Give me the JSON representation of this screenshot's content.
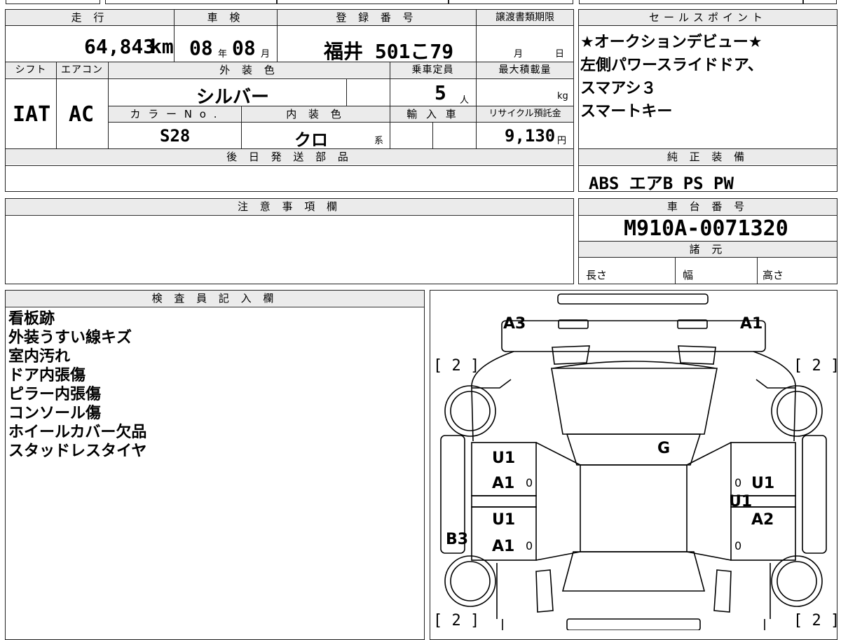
{
  "header": {
    "mileage_label": "走 行",
    "inspection_label": "車 検",
    "registration_label": "登 録 番 号",
    "transfer_label": "譲渡書類期限",
    "sales_label": "セールスポイント",
    "shift_label": "シフト",
    "ac_label": "エアコン",
    "exterior_label": "外 装 色",
    "capacity_label": "乗車定員",
    "max_load_label": "最大積載量",
    "color_no_label": "カ ラ ー N o .",
    "interior_label": "内 装 色",
    "import_label": "輸 入 車",
    "recycle_label": "リサイクル預託金",
    "later_parts_label": "後 日 発 送 部 品",
    "equipment_label": "純 正 装 備",
    "caution_label": "注 意 事 項 欄",
    "chassis_label": "車 台 番 号",
    "specs_label": "諸 元",
    "inspector_label": "検 査 員 記 入 欄"
  },
  "vehicle": {
    "mileage": "64,843",
    "mileage_unit": "km",
    "inspection_year": "08",
    "year_unit": "年",
    "inspection_month": "08",
    "month_unit": "月",
    "registration": "福井 501こ79",
    "transfer_month_unit": "月",
    "transfer_day_unit": "日",
    "shift": "IAT",
    "ac": "AC",
    "exterior_color": "シルバー",
    "capacity": "5",
    "capacity_unit": "人",
    "load_unit": "kg",
    "color_no": "S28",
    "interior_color": "クロ",
    "interior_suffix": "系",
    "recycle_fee": "9,130",
    "recycle_unit": "円",
    "chassis_number": "M910A-0071320",
    "length_label": "長さ",
    "width_label": "幅",
    "height_label": "高さ"
  },
  "sales_points": [
    "★オークションデビュー★",
    "左側パワースライドドア、",
    "スマアシ３",
    "スマートキー"
  ],
  "equipment": "ABS エアB PS PW",
  "inspector_notes": [
    "看板跡",
    "外装うすい線キズ",
    "室内汚れ",
    "ドア内張傷",
    "ピラー内張傷",
    "コンソール傷",
    "ホイールカバー欠品",
    "スタッドレスタイヤ"
  ],
  "diagram": {
    "labels": {
      "a3": "A3",
      "a1_top": "A1",
      "g": "G",
      "u1_l1": "U1",
      "a1_l1": "A1",
      "u1_l2": "U1",
      "a1_l2": "A1",
      "b3": "B3",
      "u1_r1": "U1",
      "u1_r2": "U1",
      "a2_r": "A2"
    },
    "zeros": [
      "0",
      "0",
      "0",
      "0"
    ],
    "tire_marks": [
      "[ 2 ]",
      "[ 2 ]",
      "[ 2 ]",
      "[ 2 ]"
    ]
  }
}
